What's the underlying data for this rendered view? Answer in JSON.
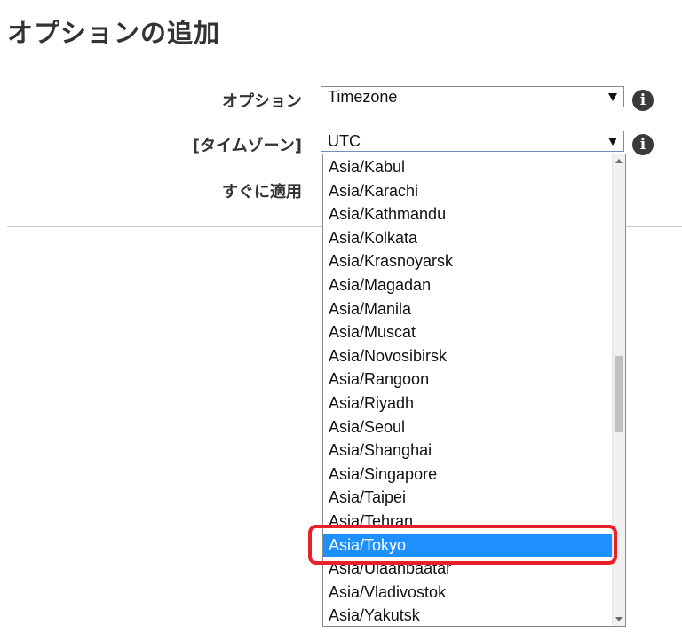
{
  "page": {
    "title": "オプションの追加"
  },
  "form": {
    "option_label": "オプション",
    "option_value": "Timezone",
    "timezone_label": "[タイムゾーン]",
    "timezone_value": "UTC",
    "apply_label": "すぐに適用",
    "info_glyph": "i"
  },
  "dropdown": {
    "options": [
      "Asia/Kabul",
      "Asia/Karachi",
      "Asia/Kathmandu",
      "Asia/Kolkata",
      "Asia/Krasnoyarsk",
      "Asia/Magadan",
      "Asia/Manila",
      "Asia/Muscat",
      "Asia/Novosibirsk",
      "Asia/Rangoon",
      "Asia/Riyadh",
      "Asia/Seoul",
      "Asia/Shanghai",
      "Asia/Singapore",
      "Asia/Taipei",
      "Asia/Tehran",
      "Asia/Tokyo",
      "Asia/Ulaanbaatar",
      "Asia/Vladivostok",
      "Asia/Yakutsk"
    ],
    "selected": "Asia/Tokyo"
  },
  "colors": {
    "highlight_frame": "#e8202a",
    "selected_background": "#1e90ff"
  },
  "icons": [
    "info-icon",
    "dropdown-arrow-icon",
    "scroll-up-icon",
    "scroll-down-icon"
  ]
}
